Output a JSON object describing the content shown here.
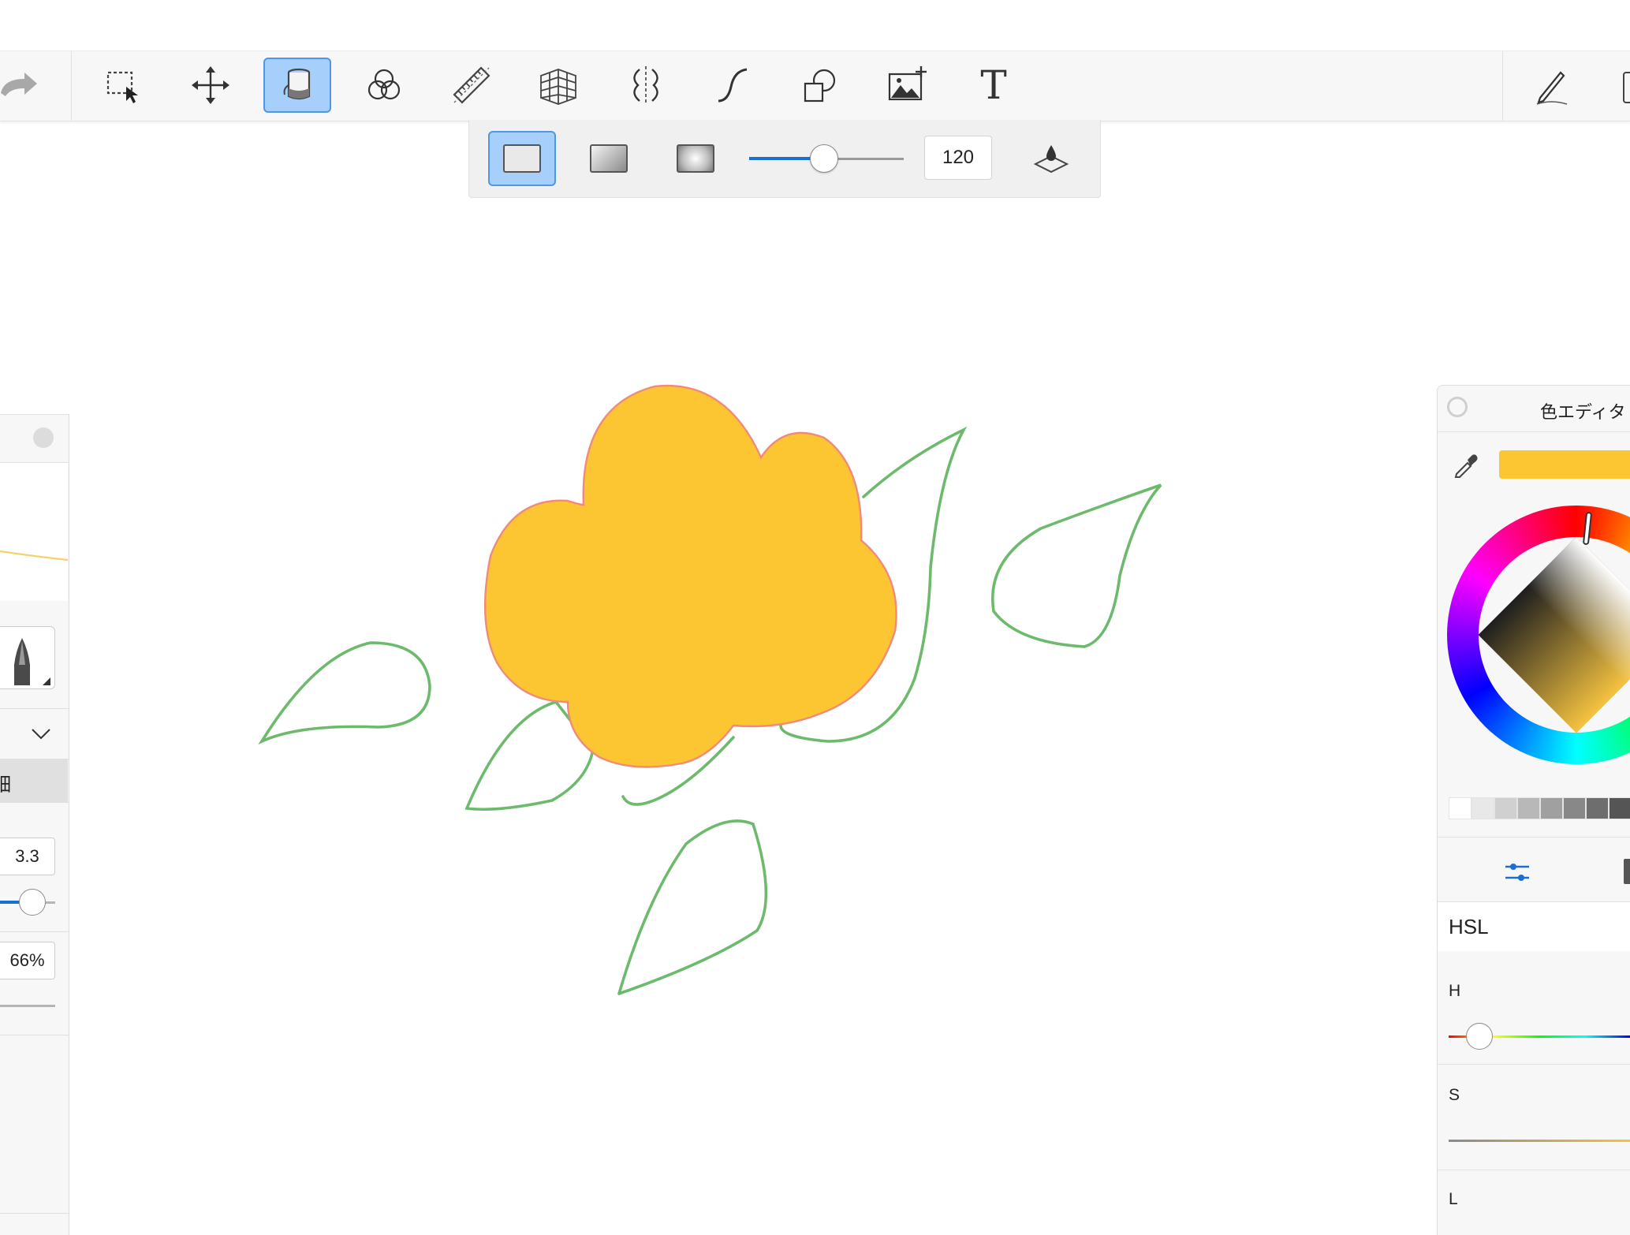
{
  "toolbar": {
    "tools": [
      {
        "id": "redo",
        "icon": "redo-arrow-icon"
      },
      {
        "id": "selection",
        "icon": "selection-icon"
      },
      {
        "id": "transform",
        "icon": "move-icon"
      },
      {
        "id": "fill",
        "icon": "fill-bucket-icon",
        "active": true
      },
      {
        "id": "blend",
        "icon": "blend-circles-icon"
      },
      {
        "id": "ruler",
        "icon": "ruler-icon"
      },
      {
        "id": "perspective",
        "icon": "perspective-grid-icon"
      },
      {
        "id": "symmetry",
        "icon": "symmetry-icon"
      },
      {
        "id": "curve",
        "icon": "curve-icon"
      },
      {
        "id": "shapes",
        "icon": "shapes-icon"
      },
      {
        "id": "add-image",
        "icon": "add-image-icon"
      },
      {
        "id": "text",
        "icon": "text-icon",
        "glyph": "T"
      },
      {
        "id": "pen",
        "icon": "pen-icon"
      }
    ]
  },
  "fill_options": {
    "modes": [
      {
        "id": "solid",
        "active": true
      },
      {
        "id": "linear-gradient",
        "active": false
      },
      {
        "id": "radial-gradient",
        "active": false
      }
    ],
    "tolerance_value": "120",
    "tolerance_fraction": 0.48
  },
  "brush_panel": {
    "size_value": "3.3",
    "size_fraction": 0.55,
    "opacity_value": "66%",
    "label_fragment": "細"
  },
  "color_editor": {
    "title": "色エディタ",
    "current_color": "#fcc632",
    "mode_label": "HSL",
    "channels": [
      "H",
      "S",
      "L"
    ],
    "hue_fraction": 0.12,
    "grayscale_swatches": [
      "#ffffff",
      "#e8e8e8",
      "#d0d0d0",
      "#b8b8b8",
      "#a0a0a0",
      "#888888",
      "#6e6e6e",
      "#555555"
    ]
  },
  "canvas": {
    "flower_color": "#fcc632",
    "outline_color": "#f08a7a",
    "leaf_color": "#6dba6d"
  }
}
